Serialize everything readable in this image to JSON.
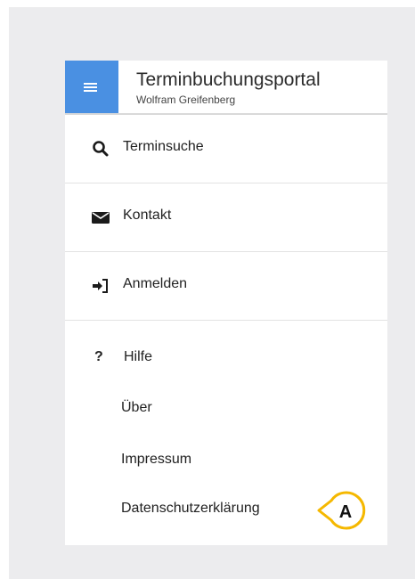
{
  "header": {
    "title": "Terminbuchungsportal",
    "subtitle": "Wolfram Greifenberg",
    "menu_icon": "hamburger-icon",
    "accent": "#4a90e2"
  },
  "nav": [
    {
      "label": "Terminsuche",
      "icon": "search-icon"
    },
    {
      "label": "Kontakt",
      "icon": "envelope-icon"
    },
    {
      "label": "Anmelden",
      "icon": "sign-in-icon"
    }
  ],
  "help": {
    "label": "Hilfe",
    "icon": "question-icon",
    "icon_glyph": "?",
    "items": [
      "Über",
      "Impressum",
      "Datenschutzerklärung"
    ]
  },
  "callout": {
    "label": "A",
    "color": "#f5b800"
  }
}
